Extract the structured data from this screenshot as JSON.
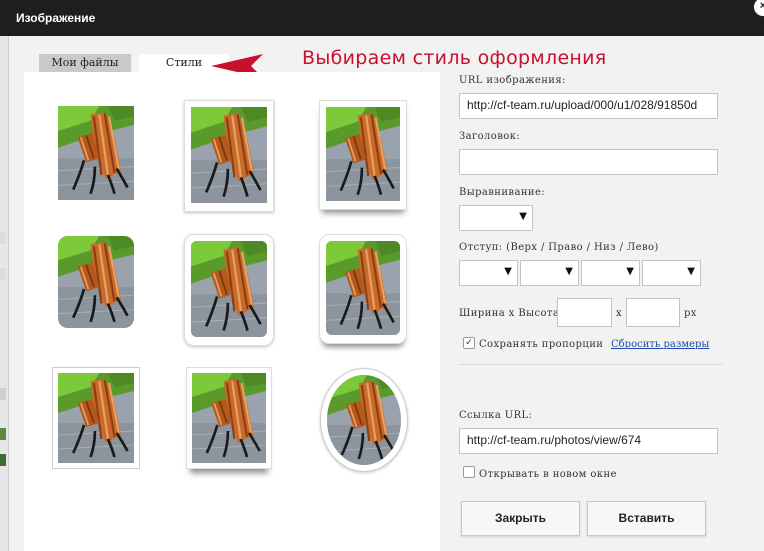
{
  "dialog": {
    "title": "Изображение",
    "close_icon": "×"
  },
  "tabs": [
    {
      "label": "Мои файлы",
      "active": false
    },
    {
      "label": "Стили",
      "active": true
    }
  ],
  "annotation": {
    "text": "Выбираем стиль оформления",
    "color": "#c8102e"
  },
  "styles_grid": {
    "count": 9
  },
  "form": {
    "url_label": "URL изображения:",
    "url_value": "http://cf-team.ru/upload/000/u1/028/91850d",
    "caption_label": "Заголовок:",
    "caption_value": "",
    "align_label": "Выравнивание:",
    "padding_label": "Отступ: (Верх / Право / Низ / Лево)",
    "size_label": "Ширина x Высота:",
    "size_sep": "x",
    "size_unit": "px",
    "keep_ratio_label": "Сохранять пропорции",
    "keep_ratio_checked": true,
    "reset_link": "Сбросить размеры",
    "link_label": "Ссылка URL:",
    "link_value": "http://cf-team.ru/photos/view/674",
    "new_window_label": "Открывать в новом окне",
    "new_window_checked": false
  },
  "buttons": {
    "close": "Закрыть",
    "insert": "Вставить"
  },
  "colors": {
    "titlebar": "#1e1e1e",
    "dialog_bg": "#f2f2f2",
    "link": "#1a4ba8"
  }
}
